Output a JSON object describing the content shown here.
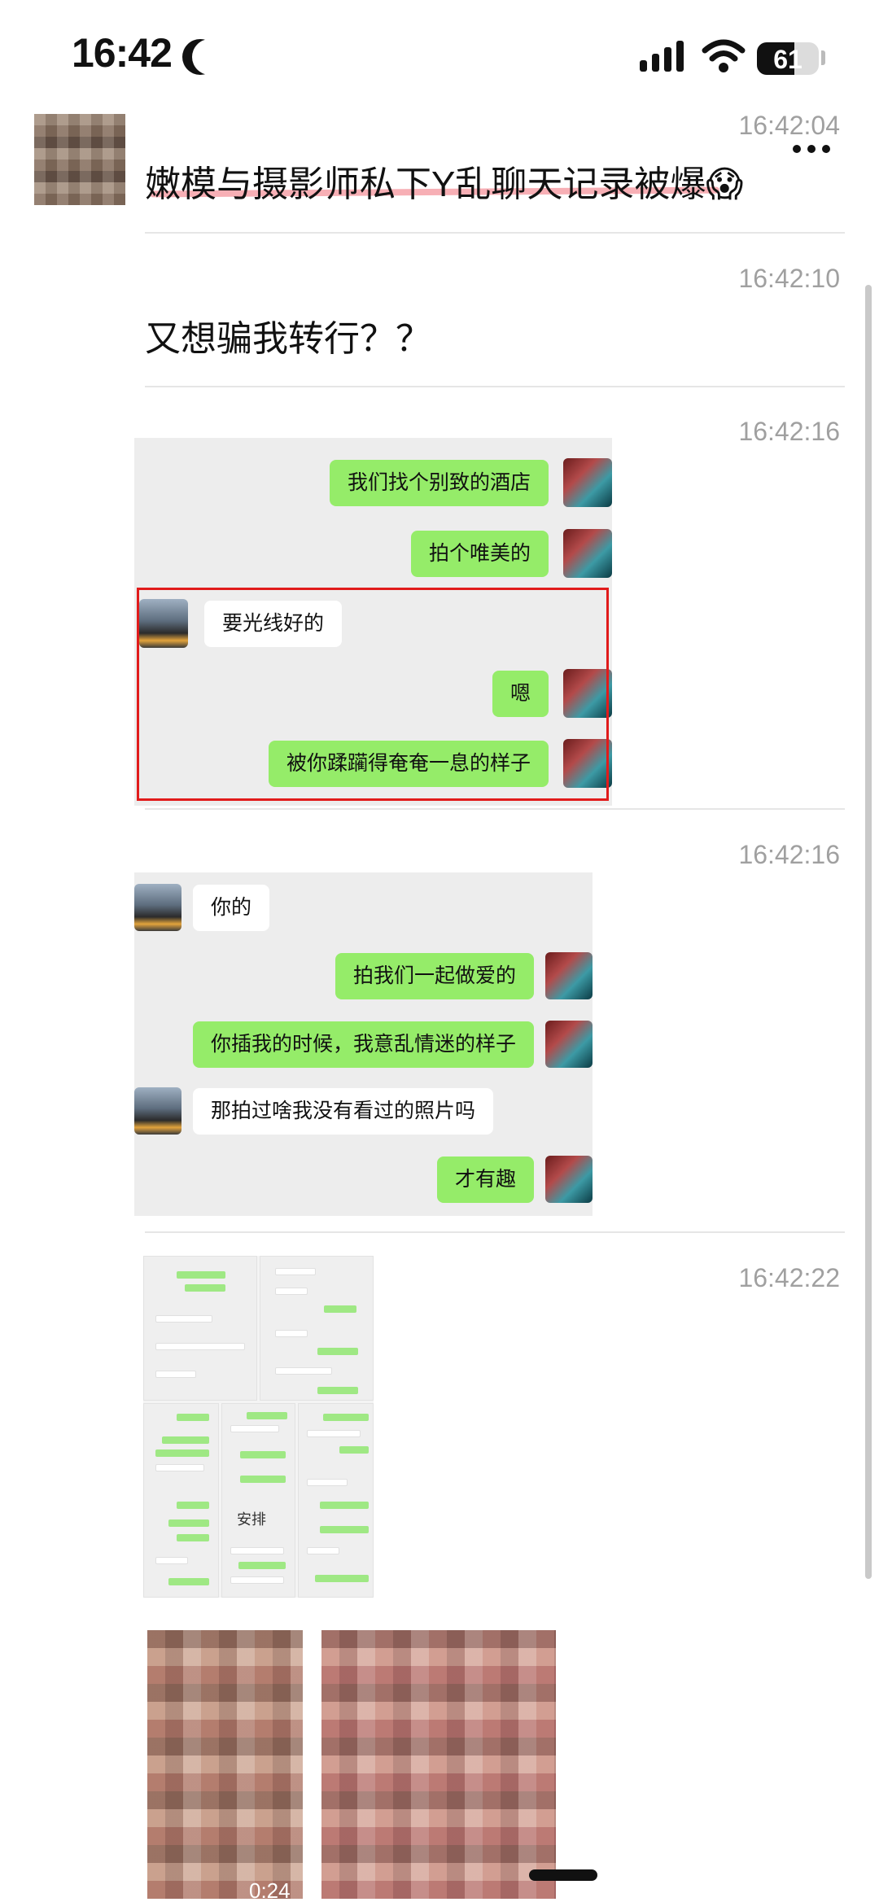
{
  "status_bar": {
    "time": "16:42",
    "battery": "61"
  },
  "post": {
    "title_message": {
      "time": "16:42:04",
      "text": "嫩模与摄影师私下Y乱聊天记录被爆😱"
    },
    "messages": [
      {
        "time": "16:42:10",
        "text": "又想骗我转行？？"
      },
      {
        "time": "16:42:16"
      },
      {
        "time": "16:42:16"
      },
      {
        "time": "16:42:22"
      }
    ]
  },
  "chat1": {
    "bubbles": [
      {
        "side": "right",
        "text": "我们找个别致的酒店"
      },
      {
        "side": "right",
        "text": "拍个唯美的"
      },
      {
        "side": "left",
        "text": "要光线好的"
      },
      {
        "side": "right",
        "text": "嗯"
      },
      {
        "side": "right",
        "text": "被你蹂躏得奄奄一息的样子"
      }
    ]
  },
  "chat2": {
    "bubbles": [
      {
        "side": "left",
        "text": "你的"
      },
      {
        "side": "right",
        "text": "拍我们一起做爱的"
      },
      {
        "side": "right",
        "text": "你插我的时候，我意乱情迷的样子"
      },
      {
        "side": "left",
        "text": "那拍过啥我没有看过的照片吗"
      },
      {
        "side": "right",
        "text": "才有趣"
      }
    ]
  },
  "collage": {
    "center_label": "安排"
  },
  "video": {
    "duration": "0:24"
  },
  "colors": {
    "bubble_green": "#95ec69",
    "timestamp_gray": "#a0a0a0",
    "highlight_red": "#e11b1b"
  },
  "icons": [
    "moon-icon",
    "signal-icon",
    "wifi-icon",
    "battery-icon",
    "more-icon"
  ]
}
